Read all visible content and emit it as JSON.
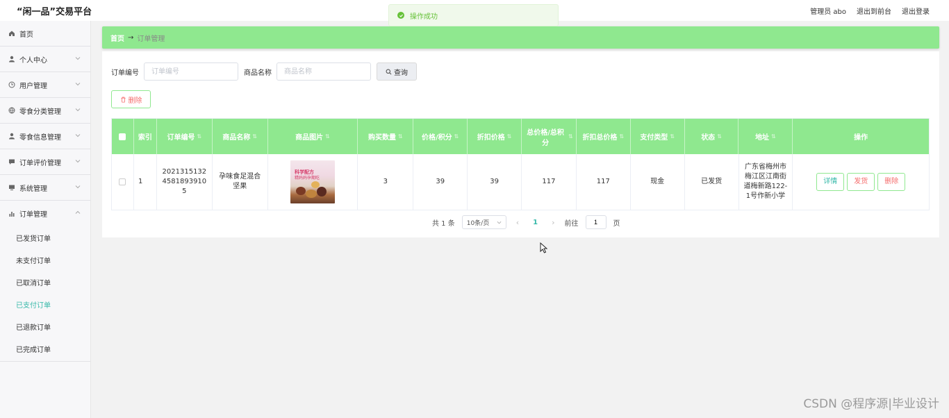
{
  "app": {
    "brand": "“闲一品”交易平台"
  },
  "topbar": {
    "admin": "管理员 abo",
    "back_front": "退出到前台",
    "logout": "退出登录"
  },
  "toast": {
    "message": "操作成功",
    "color": "#67c23a"
  },
  "sidebar": {
    "items": [
      {
        "label": "首页",
        "icon": "home-icon"
      },
      {
        "label": "个人中心",
        "icon": "user-icon"
      },
      {
        "label": "用户管理",
        "icon": "clock-icon"
      },
      {
        "label": "零食分类管理",
        "icon": "globe-icon"
      },
      {
        "label": "零食信息管理",
        "icon": "user-icon"
      },
      {
        "label": "订单评价管理",
        "icon": "comment-icon"
      },
      {
        "label": "系统管理",
        "icon": "monitor-icon"
      },
      {
        "label": "订单管理",
        "icon": "bar-chart-icon"
      }
    ],
    "sub_items": [
      {
        "label": "已发货订单"
      },
      {
        "label": "未支付订单"
      },
      {
        "label": "已取消订单"
      },
      {
        "label": "已支付订单",
        "active": true
      },
      {
        "label": "已退款订单"
      },
      {
        "label": "已完成订单"
      }
    ]
  },
  "breadcrumb": {
    "home": "首页",
    "arrow": "→",
    "current": "订单管理"
  },
  "search": {
    "order_no_label": "订单编号",
    "order_no_placeholder": "订单编号",
    "product_label": "商品名称",
    "product_placeholder": "商品名称",
    "query_button": "查询"
  },
  "actions": {
    "delete_button": "删除"
  },
  "table": {
    "headers": [
      "索引",
      "订单编号",
      "商品名称",
      "商品图片",
      "购买数量",
      "价格/积分",
      "折扣价格",
      "总价格/总积分",
      "折扣总价格",
      "支付类型",
      "状态",
      "地址",
      "操作"
    ],
    "rows": [
      {
        "index": "1",
        "order_no": "202131513245818939105",
        "product_name": "孕味食足混合坚果",
        "image_text_1": "科学配方",
        "image_text_2": "精妈妈孕期吃",
        "quantity": "3",
        "price": "39",
        "discount_price": "39",
        "total": "117",
        "discount_total": "117",
        "pay_type": "现金",
        "status": "已发货",
        "address": "广东省梅州市梅江区江南街道梅新路122-1号作新小学",
        "ops": {
          "detail": "详情",
          "ship": "发货",
          "delete": "删除"
        }
      }
    ]
  },
  "pagination": {
    "total": "共 1 条",
    "page_size": "10条/页",
    "current": "1",
    "goto_label": "前往",
    "goto_value": "1",
    "page_suffix": "页"
  },
  "watermark": "CSDN @程序源|毕业设计",
  "colors": {
    "accent_green": "#8fe88f",
    "link_teal": "#35b8a8",
    "danger": "#f56c6c"
  }
}
